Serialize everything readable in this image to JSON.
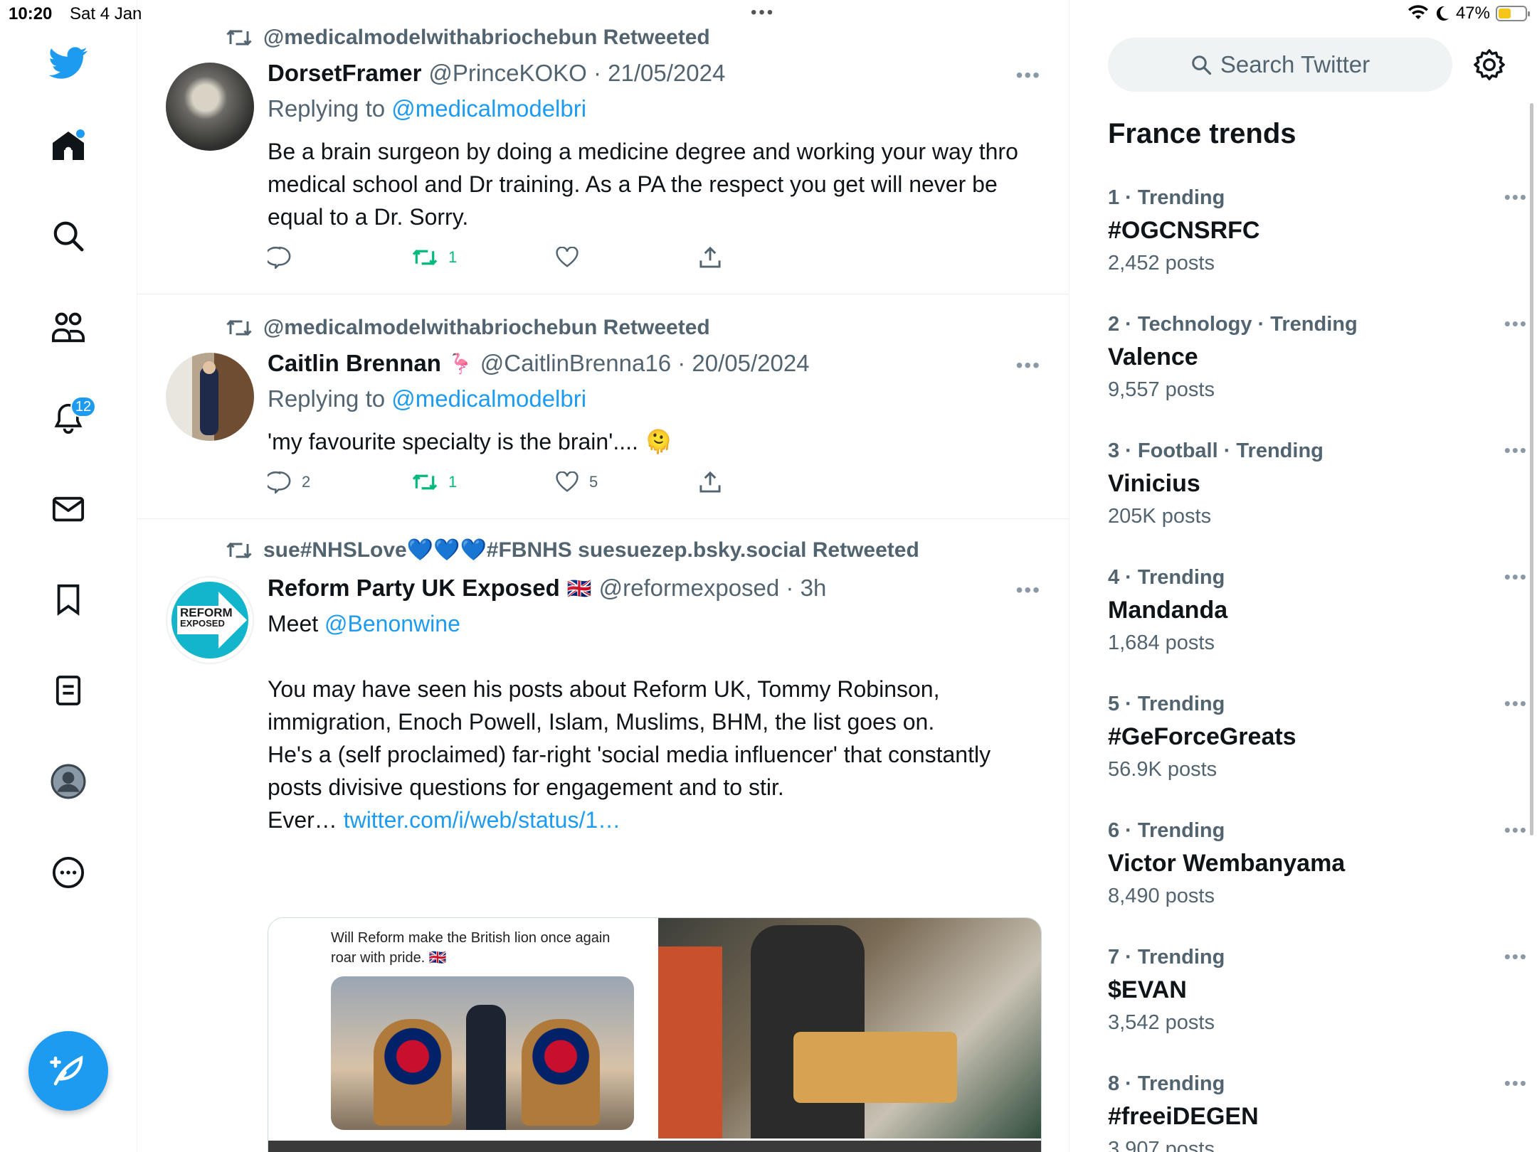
{
  "status": {
    "time": "10:20",
    "date": "Sat 4 Jan",
    "battery": "47%",
    "battery_level": 0.47
  },
  "nav": {
    "notification_count": "12"
  },
  "tweets": [
    {
      "retweeted_by": "@medicalmodelwithabriochebun Retweeted",
      "name": "DorsetFramer",
      "handle": "@PrinceKOKO · 21/05/2024",
      "reply_prefix": "Replying to",
      "reply_handle": "@medicalmodelbri",
      "text": "Be a brain surgeon by doing a medicine degree and working your way thro medical school and Dr training. As a PA the respect you get will never be equal to a Dr. Sorry.",
      "replies": "",
      "retweets": "1",
      "likes": ""
    },
    {
      "retweeted_by": "@medicalmodelwithabriochebun Retweeted",
      "name": "Caitlin Brennan",
      "name_emoji": "🦩",
      "handle": "@CaitlinBrenna16 · 20/05/2024",
      "reply_prefix": "Replying to",
      "reply_handle": "@medicalmodelbri",
      "text": "'my favourite specialty is the brain'.... 🫠",
      "replies": "2",
      "retweets": "1",
      "likes": "5"
    },
    {
      "retweeted_by": "sue#NHSLove💙💙💙#FBNHS suesuezep.bsky.social Retweeted",
      "name": "Reform Party UK Exposed",
      "name_emoji": "🇬🇧",
      "handle": "@reformexposed · 3h",
      "avatar_text_1": "REFORM",
      "avatar_text_2": "EXPOSED",
      "meet_prefix": "Meet",
      "meet_handle": "@Benonwine",
      "para1": "You may have seen his posts about Reform UK, Tommy Robinson, immigration, Enoch Powell, Islam, Muslims, BHM, the list goes on.",
      "para2": "He's a (self proclaimed) far-right 'social media influencer' that constantly posts divisive questions for engagement and to stir.",
      "ever_prefix": "Ever…",
      "ever_link": "twitter.com/i/web/status/1…",
      "media_caption": "Will Reform make the British lion once again roar with pride. 🇬🇧"
    }
  ],
  "search": {
    "placeholder": "Search Twitter"
  },
  "trends": {
    "title": "France trends",
    "items": [
      {
        "meta": "1 · Trending",
        "name": "#OGCNSRFC",
        "posts": "2,452 posts"
      },
      {
        "meta": "2 · Technology · Trending",
        "name": "Valence",
        "posts": "9,557 posts"
      },
      {
        "meta": "3 · Football · Trending",
        "name": "Vinicius",
        "posts": "205K posts"
      },
      {
        "meta": "4 · Trending",
        "name": "Mandanda",
        "posts": "1,684 posts"
      },
      {
        "meta": "5 · Trending",
        "name": "#GeForceGreats",
        "posts": "56.9K posts"
      },
      {
        "meta": "6 · Trending",
        "name": "Victor Wembanyama",
        "posts": "8,490 posts"
      },
      {
        "meta": "7 · Trending",
        "name": "$EVAN",
        "posts": "3,542 posts"
      },
      {
        "meta": "8 · Trending",
        "name": "#freeiDEGEN",
        "posts": "3,907 posts"
      }
    ]
  },
  "colors": {
    "accent": "#1d9bf0",
    "retweet_green": "#00ba7c",
    "muted": "#536471"
  }
}
